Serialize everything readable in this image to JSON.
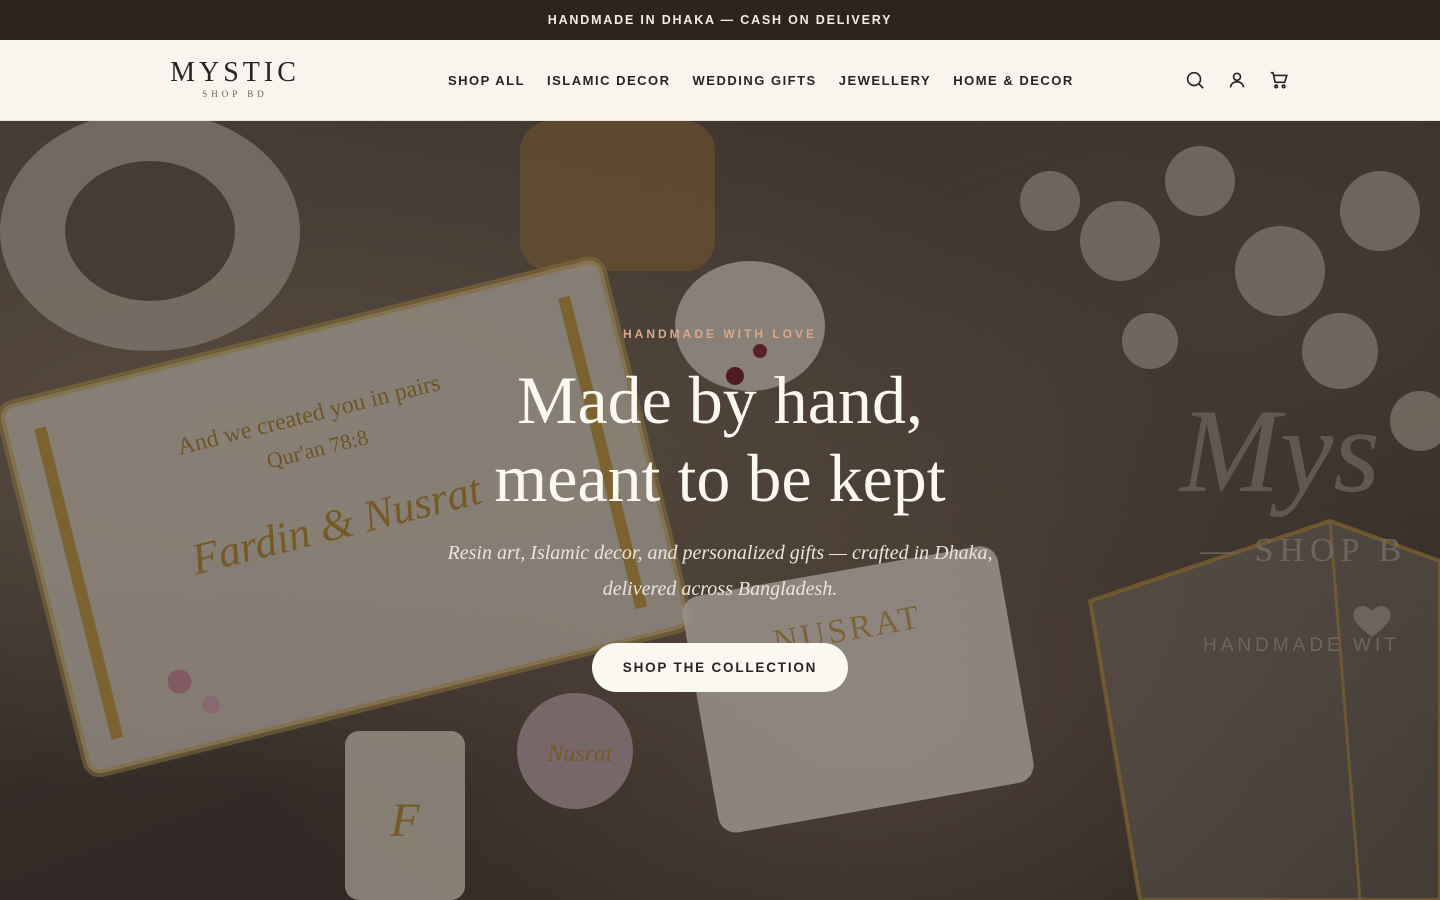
{
  "announcement": {
    "text": "HANDMADE IN DHAKA — CASH ON DELIVERY"
  },
  "header": {
    "logo_main": "MYSTIC",
    "logo_sub": "SHOP BD",
    "nav": [
      {
        "label": "SHOP ALL"
      },
      {
        "label": "ISLAMIC DECOR"
      },
      {
        "label": "WEDDING GIFTS"
      },
      {
        "label": "JEWELLERY"
      },
      {
        "label": "HOME & DECOR"
      }
    ],
    "icons": [
      "search-icon",
      "account-icon",
      "cart-icon"
    ]
  },
  "hero": {
    "eyebrow": "HANDMADE WITH LOVE",
    "title_line1": "Made by hand,",
    "title_line2": "meant to be kept",
    "subtitle": "Resin art, Islamic decor, and personalized gifts — crafted in Dhaka, delivered across Bangladesh.",
    "cta_label": "SHOP THE COLLECTION"
  },
  "hero_image_text": {
    "tray_line1": "And we created you in pairs",
    "tray_line2": "Qur'an 78:8",
    "tray_names": "Fardin & Nusrat",
    "block_name": "NUSRAT",
    "keychain_letter": "F",
    "keychain_name": "Nusrat",
    "box_brand": "Mys",
    "box_sub": "— SHOP B",
    "box_tag": "HANDMADE WIT"
  },
  "colors": {
    "announcement_bg": "#2d241e",
    "header_bg": "#f8f5ef",
    "accent": "#d9a98a",
    "cta_bg": "#fbf7f1",
    "text_dark": "#2b2320"
  }
}
